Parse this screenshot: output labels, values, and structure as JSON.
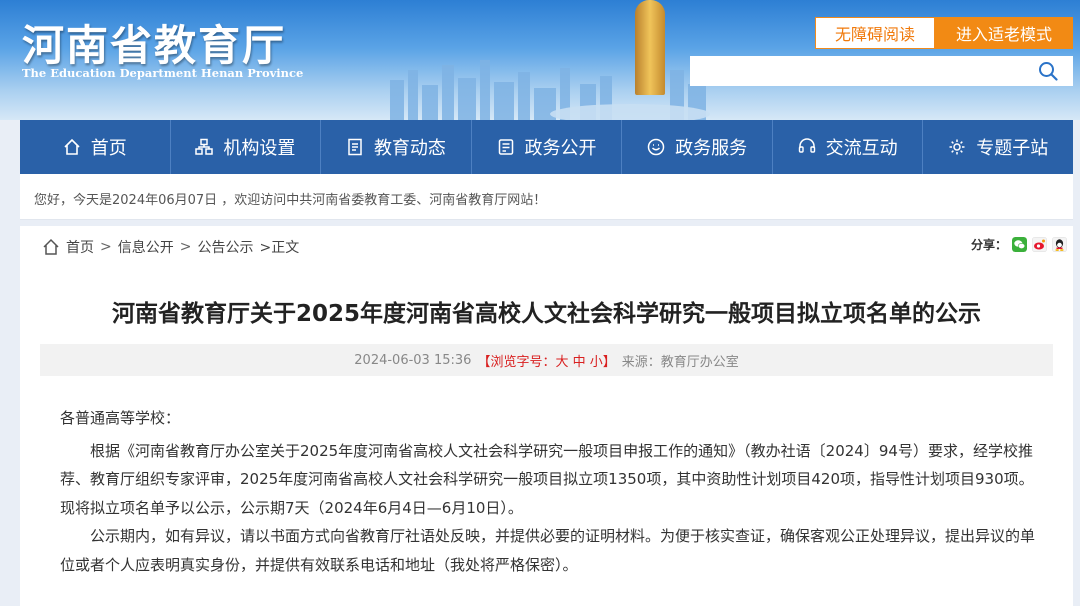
{
  "header": {
    "site_title": "河南省教育厅",
    "site_subtitle": "The Education Department Henan Province",
    "accessibility_label": "无障碍阅读",
    "elder_mode_label": "进入适老模式",
    "search_placeholder": ""
  },
  "nav": {
    "items": [
      {
        "label": "首页",
        "icon": "home-icon"
      },
      {
        "label": "机构设置",
        "icon": "org-icon"
      },
      {
        "label": "教育动态",
        "icon": "news-icon"
      },
      {
        "label": "政务公开",
        "icon": "gov-open-icon"
      },
      {
        "label": "政务服务",
        "icon": "service-icon"
      },
      {
        "label": "交流互动",
        "icon": "interact-icon"
      },
      {
        "label": "专题子站",
        "icon": "subsite-icon"
      }
    ]
  },
  "welcome": {
    "text": "您好，今天是2024年06月07日 ，欢迎访问中共河南省委教育工委、河南省教育厅网站！"
  },
  "breadcrumb": {
    "home": "首页",
    "sep": ">",
    "level1": "信息公开",
    "level2": "公告公示",
    "current": ">正文"
  },
  "share": {
    "label": "分享：",
    "icons": [
      "wechat-icon",
      "weibo-icon",
      "qq-icon"
    ]
  },
  "article": {
    "title": "河南省教育厅关于2025年度河南省高校人文社会科学研究一般项目拟立项名单的公示",
    "meta_date": "2024-06-03 15:36",
    "meta_font": "【浏览字号：大 中 小】",
    "meta_source": "来源：教育厅办公室",
    "salutation": "各普通高等学校：",
    "paragraphs": [
      "根据《河南省教育厅办公室关于2025年度河南省高校人文社会科学研究一般项目申报工作的通知》（教办社语〔2024〕94号）要求，经学校推荐、教育厅组织专家评审，2025年度河南省高校人文社会科学研究一般项目拟立项1350项，其中资助性计划项目420项，指导性计划项目930项。现将拟立项名单予以公示，公示期7天（2024年6月4日—6月10日）。",
      "公示期内，如有异议，请以书面方式向省教育厅社语处反映，并提供必要的证明材料。为便于核实查证，确保客观公正处理异议，提出异议的单位或者个人应表明真实身份，并提供有效联系电话和地址（我处将严格保密）。"
    ]
  },
  "colors": {
    "nav_bg": "#2a61a8",
    "accent_orange": "#f28a14",
    "alert_red": "#d92020"
  }
}
